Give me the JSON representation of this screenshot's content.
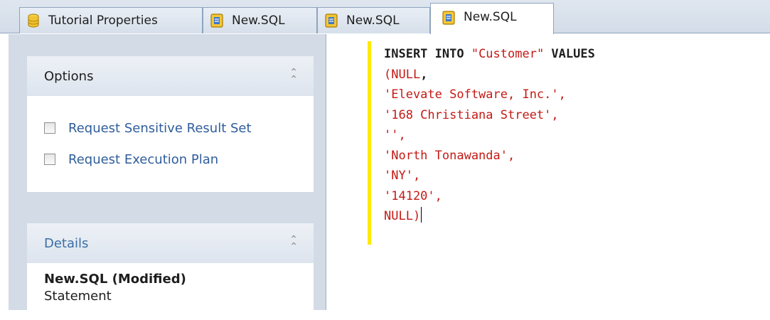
{
  "tabs": [
    {
      "label": "Tutorial Properties",
      "icon": "database-icon",
      "active": false
    },
    {
      "label": "New.SQL",
      "icon": "sql-file-icon",
      "active": false
    },
    {
      "label": "New.SQL",
      "icon": "sql-file-icon",
      "active": false
    },
    {
      "label": "New.SQL",
      "icon": "sql-file-icon",
      "active": true
    }
  ],
  "options": {
    "title": "Options",
    "items": [
      {
        "label": "Request Sensitive Result Set",
        "checked": false
      },
      {
        "label": "Request Execution Plan",
        "checked": false
      }
    ]
  },
  "details": {
    "title": "Details",
    "name": "New.SQL (Modified)",
    "type": "Statement"
  },
  "editor": {
    "lines": [
      {
        "parts": [
          {
            "text": "INSERT INTO ",
            "kind": "kw"
          },
          {
            "text": "\"Customer\"",
            "kind": "str"
          },
          {
            "text": " VALUES",
            "kind": "kw"
          }
        ]
      },
      {
        "parts": [
          {
            "text": "(",
            "kind": "str"
          },
          {
            "text": "NULL",
            "kind": "str"
          },
          {
            "text": ",",
            "kind": "kw"
          }
        ]
      },
      {
        "parts": [
          {
            "text": "'Elevate Software, Inc.'",
            "kind": "str"
          },
          {
            "text": ",",
            "kind": "str"
          }
        ]
      },
      {
        "parts": [
          {
            "text": "'168 Christiana Street'",
            "kind": "str"
          },
          {
            "text": ",",
            "kind": "str"
          }
        ]
      },
      {
        "parts": [
          {
            "text": "''",
            "kind": "str"
          },
          {
            "text": ",",
            "kind": "str"
          }
        ]
      },
      {
        "parts": [
          {
            "text": "'North Tonawanda'",
            "kind": "str"
          },
          {
            "text": ",",
            "kind": "str"
          }
        ]
      },
      {
        "parts": [
          {
            "text": "'NY'",
            "kind": "str"
          },
          {
            "text": ",",
            "kind": "str"
          }
        ]
      },
      {
        "parts": [
          {
            "text": "'14120'",
            "kind": "str"
          },
          {
            "text": ",",
            "kind": "str"
          }
        ]
      },
      {
        "parts": [
          {
            "text": "NULL)",
            "kind": "str"
          }
        ]
      }
    ],
    "colors": {
      "keyword": "#1e1e1e",
      "string": "#c41a16",
      "change_bar": "#ffe900"
    }
  }
}
